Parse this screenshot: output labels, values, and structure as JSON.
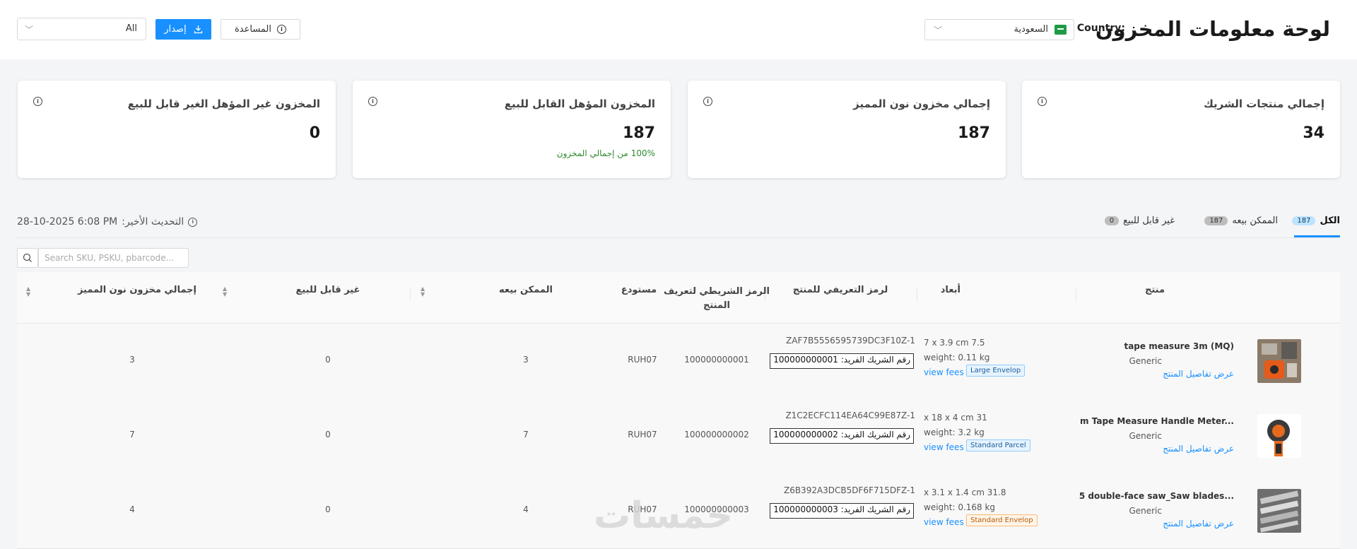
{
  "header": {
    "title": "لوحة معلومات المخزون",
    "country_label": "Country:",
    "country_value": "السعودية",
    "filter_value": "All",
    "issue_button": "إصدار",
    "help_button": "المساعدة"
  },
  "cards": [
    {
      "title": "إجمالي منتجات الشريك",
      "value": "34",
      "sub": ""
    },
    {
      "title": "إجمالي مخزون نون المميز",
      "value": "187",
      "sub": ""
    },
    {
      "title": "المخزون المؤهل القابل للبيع",
      "value": "187",
      "sub": "100% من إجمالي المخزون"
    },
    {
      "title": "المخزون غير المؤهل الغير قابل للبيع",
      "value": "0",
      "sub": ""
    }
  ],
  "tabs": [
    {
      "label": "الكل",
      "count": "187",
      "active": true
    },
    {
      "label": "الممكن بيعه",
      "count": "187",
      "active": false
    },
    {
      "label": "غير قابل للبيع",
      "count": "0",
      "active": false
    }
  ],
  "last_update_label": "التحديث الأخير:",
  "last_update_value": "28-10-2025 6:08 PM",
  "search": {
    "placeholder": "Search SKU, PSKU, pbarcode..."
  },
  "table": {
    "headers": {
      "product": "منتج",
      "dimensions": "أبعاد",
      "sku_id": "لرمز التعريفي للمنتج",
      "barcode": "الرمز الشريطي لتعريف المنتج",
      "warehouse": "مستودع",
      "sellable": "الممكن بيعه",
      "unsellable": "غير قابل للبيع",
      "total": "إجمالي مخزون نون المميز"
    },
    "view_details": "عرض تفاصيل المنتج",
    "view_fees": "view fees",
    "rows": [
      {
        "name": "tape measure 3m (MQ)",
        "brand": "Generic",
        "dim1": "7 x 3.9 cm 7.5",
        "dim2": "weight: 0.11 kg",
        "tag": "Large Envelop",
        "tag_color": "blue",
        "sku": "ZAF7B5556595739DC3F10Z-1",
        "uid": "رقم الشريك الفريد: 100000000001",
        "barcode": "100000000001",
        "warehouse": "RUH07",
        "sellable": "3",
        "unsellable": "0",
        "total": "3"
      },
      {
        "name": "m Tape Measure Handle Meter...",
        "brand": "Generic",
        "dim1": "x 18 x 4 cm 31",
        "dim2": "weight: 3.2 kg",
        "tag": "Standard Parcel",
        "tag_color": "blue",
        "sku": "Z1C2ECFC114EA64C99E87Z-1",
        "uid": "رقم الشريك الفريد: 100000000002",
        "barcode": "100000000002",
        "warehouse": "RUH07",
        "sellable": "7",
        "unsellable": "0",
        "total": "7"
      },
      {
        "name": "5 double-face saw_Saw blades...",
        "brand": "Generic",
        "dim1": "x 3.1 x 1.4 cm 31.8",
        "dim2": "weight: 0.168 kg",
        "tag": "Standard Envelop",
        "tag_color": "orange",
        "sku": "Z6B392A3DCB5DF6F715DFZ-1",
        "uid": "رقم الشريك الفريد: 100000000003",
        "barcode": "100000000003",
        "warehouse": "RUH07",
        "sellable": "4",
        "unsellable": "0",
        "total": "4"
      }
    ]
  },
  "watermark": "خمسات",
  "colors": {
    "primary": "#1890ff",
    "success": "#2e8b2e",
    "orange_tag": "#b45a09"
  }
}
